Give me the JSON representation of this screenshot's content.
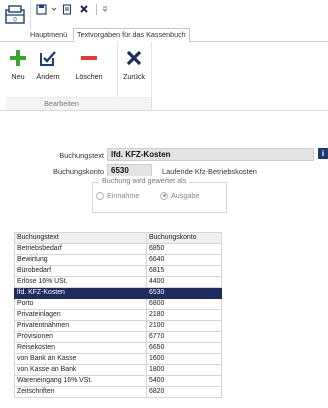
{
  "quick_access": {
    "icons": [
      "save-icon",
      "new-document-icon",
      "close-icon",
      "dropdown-arrow-icon"
    ]
  },
  "tabs": [
    {
      "label": "Hauptmenü",
      "active": false
    },
    {
      "label": "Textvorgaben für das Kassenbuch",
      "active": true
    }
  ],
  "ribbon": {
    "groups": [
      {
        "label": "Bearbeiten",
        "buttons": [
          {
            "label": "Neu",
            "icon": "plus-icon",
            "color": "#3aa535"
          },
          {
            "label": "Ändern",
            "icon": "edit-icon",
            "color": "#1f3f6e"
          },
          {
            "label": "Löschen",
            "icon": "minus-icon",
            "color": "#e53935"
          }
        ]
      },
      {
        "label": "",
        "buttons": [
          {
            "label": "Zurück",
            "icon": "x-icon",
            "color": "#1f2a5e"
          }
        ]
      }
    ]
  },
  "form": {
    "buchungstext_label": "Buchungstext",
    "buchungstext_value": "lfd. KFZ-Kosten",
    "buchungskonto_label": "Buchungskonto",
    "buchungskonto_value": "6530",
    "buchungskonto_name": "Laufende Kfz-Betriebskosten",
    "info_icon": "i",
    "group_title": "Buchung wird gewertet als",
    "radio_einnahme": "Einnahme",
    "radio_ausgabe": "Ausgabe",
    "selected": "Ausgabe"
  },
  "table": {
    "columns": [
      "Buchungstext",
      "Buchungskonto"
    ],
    "rows": [
      {
        "text": "Betriebsbedarf",
        "konto": "6850"
      },
      {
        "text": "Bewirtung",
        "konto": "6640"
      },
      {
        "text": "Bürobedarf",
        "konto": "6815"
      },
      {
        "text": "Erlöse 16% USt.",
        "konto": "4400"
      },
      {
        "text": "lfd. KFZ-Kosten",
        "konto": "6530"
      },
      {
        "text": "Porto",
        "konto": "6800"
      },
      {
        "text": "Privateinlagen",
        "konto": "2180"
      },
      {
        "text": "Privatentnahmen",
        "konto": "2100"
      },
      {
        "text": "Provisionen",
        "konto": "6770"
      },
      {
        "text": "Reisekosten",
        "konto": "6650"
      },
      {
        "text": "von Bank an Kasse",
        "konto": "1600"
      },
      {
        "text": "von Kasse an Bank",
        "konto": "1800"
      },
      {
        "text": "Wareneingang 16% VSt.",
        "konto": "5400"
      },
      {
        "text": "Zeitschriften",
        "konto": "6820"
      }
    ],
    "selected_index": 4
  },
  "colors": {
    "selection": "#1f2a5e",
    "field_bg": "#e3e3e3",
    "info_icon_bg": "#1e3a6e"
  }
}
